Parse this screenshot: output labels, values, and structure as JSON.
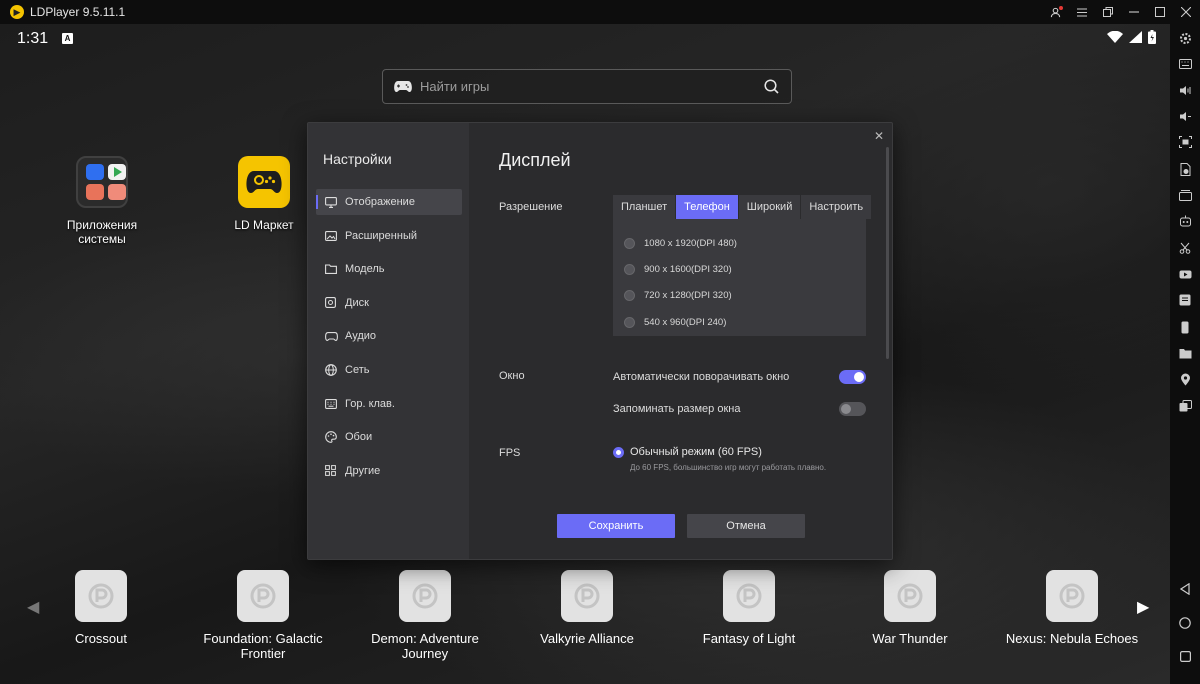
{
  "window": {
    "title": "LDPlayer 9.5.11.1",
    "controls": [
      "account-icon",
      "menu-icon",
      "restore-window-icon",
      "minimize-icon",
      "maximize-icon",
      "close-icon"
    ]
  },
  "statusbar": {
    "time": "1:31",
    "badge": "A"
  },
  "search": {
    "placeholder": "Найти игры"
  },
  "desktop": [
    {
      "label": "Приложения системы",
      "icon": "system-apps-folder-icon"
    },
    {
      "label": "LD Маркет",
      "icon": "ld-market-icon"
    }
  ],
  "dock": [
    {
      "label": "Crossout"
    },
    {
      "label": "Foundation: Galactic Frontier"
    },
    {
      "label": "Demon: Adventure Journey"
    },
    {
      "label": "Valkyrie Alliance"
    },
    {
      "label": "Fantasy of Light"
    },
    {
      "label": "War Thunder"
    },
    {
      "label": "Nexus: Nebula Echoes"
    }
  ],
  "settings": {
    "title": "Настройки",
    "nav": [
      {
        "label": "Отображение",
        "icon": "monitor-icon",
        "active": true
      },
      {
        "label": "Расширенный",
        "icon": "image-icon",
        "active": false
      },
      {
        "label": "Модель",
        "icon": "folder-icon",
        "active": false
      },
      {
        "label": "Диск",
        "icon": "disk-icon",
        "active": false
      },
      {
        "label": "Аудио",
        "icon": "gamepad-icon",
        "active": false
      },
      {
        "label": "Сеть",
        "icon": "globe-icon",
        "active": false
      },
      {
        "label": "Гор. клав.",
        "icon": "keyboard-icon",
        "active": false
      },
      {
        "label": "Обои",
        "icon": "palette-icon",
        "active": false
      },
      {
        "label": "Другие",
        "icon": "grid-icon",
        "active": false
      }
    ],
    "display": {
      "heading": "Дисплей",
      "resolution_label": "Разрешение",
      "tabs": [
        {
          "label": "Планшет",
          "active": false
        },
        {
          "label": "Телефон",
          "active": true
        },
        {
          "label": "Широкий",
          "active": false
        },
        {
          "label": "Настроить",
          "active": false
        }
      ],
      "resolutions": [
        "1080 x 1920(DPI 480)",
        "900 x 1600(DPI 320)",
        "720 x 1280(DPI 320)",
        "540 x 960(DPI 240)"
      ],
      "window_label": "Окно",
      "auto_rotate": {
        "label": "Автоматически поворачивать окно",
        "on": true
      },
      "remember_size": {
        "label": "Запоминать размер окна",
        "on": false
      },
      "fps_label": "FPS",
      "fps_option": "Обычный режим (60 FPS)",
      "fps_hint": "До 60 FPS, большинство игр могут работать плавно.",
      "save": "Сохранить",
      "cancel": "Отмена"
    }
  },
  "colors": {
    "accent": "#6b6cf6",
    "brand_yellow": "#f5c400",
    "dialog_bg": "#2b2b2d",
    "sidebar_bg": "#333336"
  }
}
